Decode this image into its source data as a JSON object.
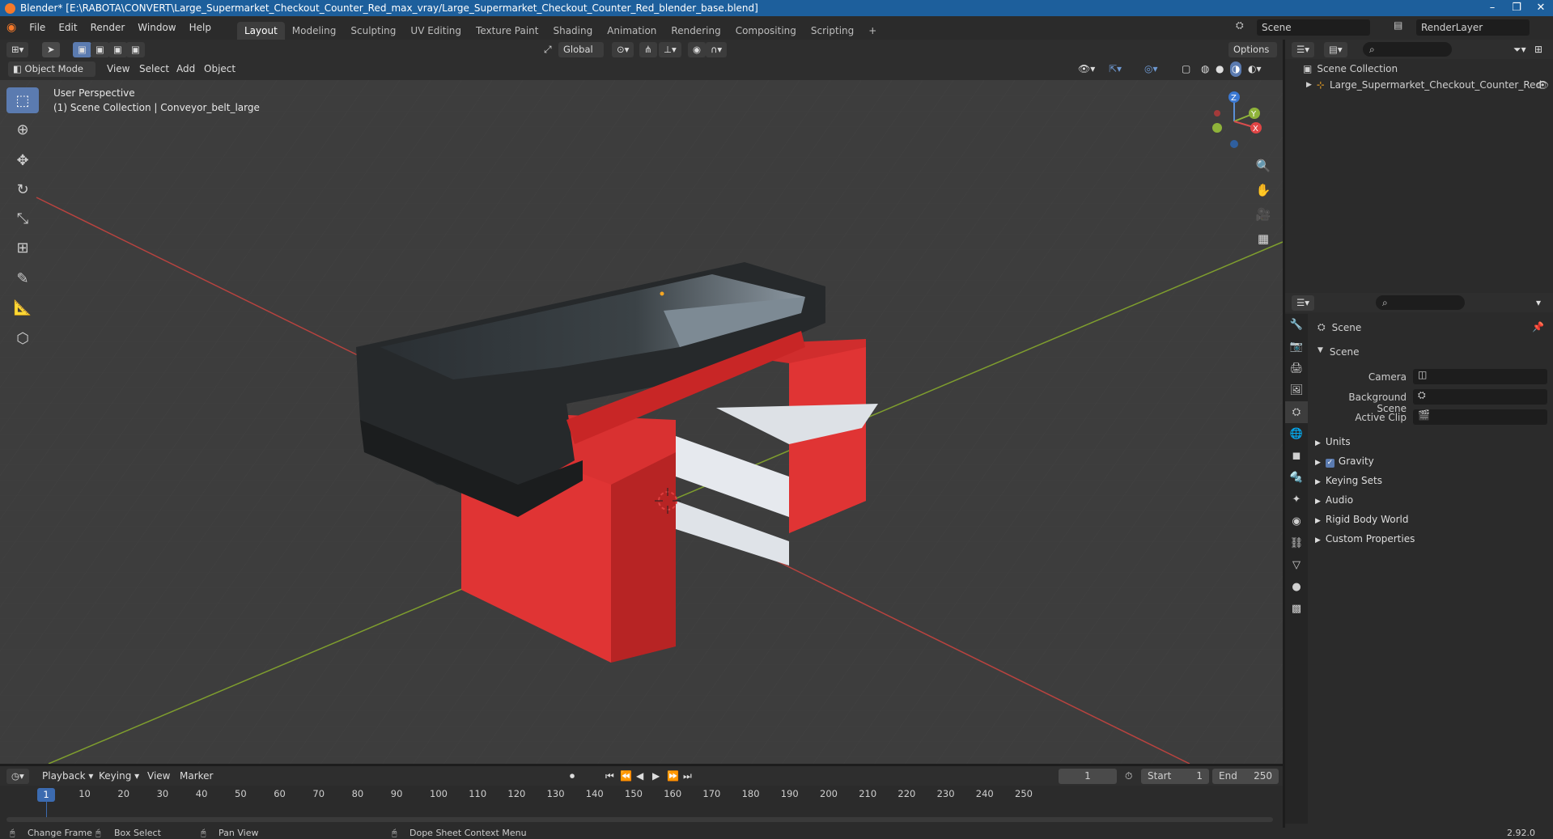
{
  "window": {
    "title": "Blender* [E:\\RABOTA\\CONVERT\\Large_Supermarket_Checkout_Counter_Red_max_vray/Large_Supermarket_Checkout_Counter_Red_blender_base.blend]"
  },
  "menu": [
    "File",
    "Edit",
    "Render",
    "Window",
    "Help"
  ],
  "workspaces": [
    "Layout",
    "Modeling",
    "Sculpting",
    "UV Editing",
    "Texture Paint",
    "Shading",
    "Animation",
    "Rendering",
    "Compositing",
    "Scripting"
  ],
  "active_workspace": "Layout",
  "scene": {
    "name": "Scene",
    "render_layer": "RenderLayer"
  },
  "viewport_header": {
    "transform_orientation": "Global",
    "options_label": "Options",
    "mode": "Object Mode",
    "menus": [
      "View",
      "Select",
      "Add",
      "Object"
    ]
  },
  "viewport": {
    "perspective": "User Perspective",
    "collection_info": "(1) Scene Collection | Conveyor_belt_large",
    "gizmo_axes": [
      "Z",
      "Y",
      "X"
    ]
  },
  "outliner": {
    "root": "Scene Collection",
    "items": [
      {
        "name": "Large_Supermarket_Checkout_Counter_Red"
      }
    ]
  },
  "properties": {
    "context": "Scene",
    "panel": "Scene",
    "fields": [
      {
        "label": "Camera"
      },
      {
        "label": "Background Scene"
      },
      {
        "label": "Active Clip"
      }
    ],
    "subpanels": [
      "Units",
      "Gravity",
      "Keying Sets",
      "Audio",
      "Rigid Body World",
      "Custom Properties"
    ],
    "gravity_checked": true
  },
  "timeline": {
    "menus": [
      "Playback",
      "Keying",
      "View",
      "Marker"
    ],
    "current_frame": "1",
    "start_label": "Start",
    "start": "1",
    "end_label": "End",
    "end": "250",
    "ruler": [
      "1",
      "10",
      "20",
      "30",
      "40",
      "50",
      "60",
      "70",
      "80",
      "90",
      "100",
      "110",
      "120",
      "130",
      "140",
      "150",
      "160",
      "170",
      "180",
      "190",
      "200",
      "210",
      "220",
      "230",
      "240",
      "250"
    ]
  },
  "statusbar": {
    "items": [
      "Change Frame",
      "Box Select",
      "Pan View",
      "Dope Sheet Context Menu"
    ],
    "version": "2.92.0"
  },
  "colors": {
    "accent": "#5b7bb0",
    "titlebar": "#1d5f9c",
    "counter_red": "#e03434",
    "x_axis": "#b8433f",
    "y_axis": "#7f9e2e"
  }
}
